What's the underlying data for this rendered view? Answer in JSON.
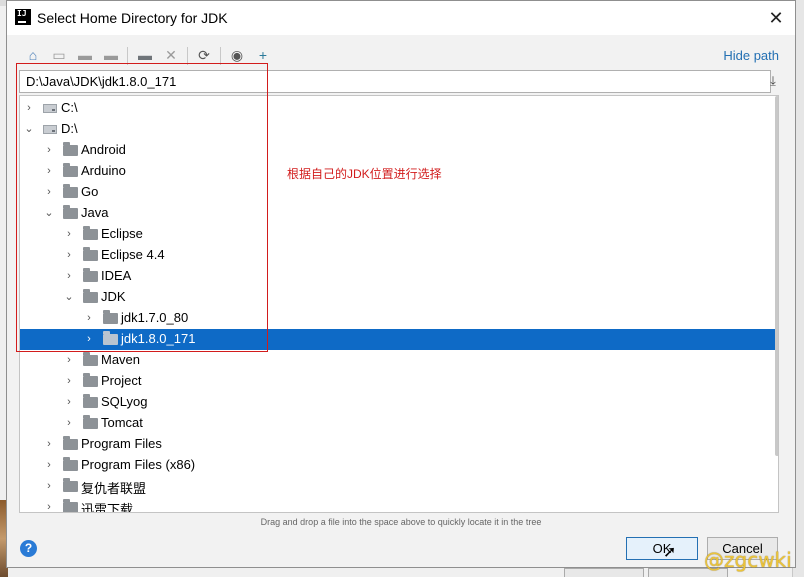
{
  "dialog": {
    "title": "Select Home Directory for JDK",
    "app_icon_text": "IJ"
  },
  "toolbar": {
    "hide_path_label": "Hide path",
    "icons": [
      "home-icon",
      "desktop-icon",
      "project-folder-icon",
      "module-folder-icon",
      "new-folder-icon",
      "delete-icon",
      "refresh-icon",
      "show-hidden-icon",
      "add-icon"
    ]
  },
  "path": {
    "value": "D:\\Java\\JDK\\jdk1.8.0_171"
  },
  "tree": {
    "items": [
      {
        "label": "C:\\",
        "type": "drive",
        "expanded": false
      },
      {
        "label": "D:\\",
        "type": "drive",
        "expanded": true
      },
      {
        "label": "Android",
        "type": "folder",
        "expanded": false
      },
      {
        "label": "Arduino",
        "type": "folder",
        "expanded": false
      },
      {
        "label": "Go",
        "type": "folder",
        "expanded": false
      },
      {
        "label": "Java",
        "type": "folder",
        "expanded": true
      },
      {
        "label": "Eclipse",
        "type": "folder",
        "expanded": false
      },
      {
        "label": "Eclipse 4.4",
        "type": "folder",
        "expanded": false
      },
      {
        "label": "IDEA",
        "type": "folder",
        "expanded": false
      },
      {
        "label": "JDK",
        "type": "folder",
        "expanded": true
      },
      {
        "label": "jdk1.7.0_80",
        "type": "folder",
        "expanded": false
      },
      {
        "label": "jdk1.8.0_171",
        "type": "folder",
        "expanded": false,
        "selected": true
      },
      {
        "label": "Maven",
        "type": "folder",
        "expanded": false
      },
      {
        "label": "Project",
        "type": "folder",
        "expanded": false
      },
      {
        "label": "SQLyog",
        "type": "folder",
        "expanded": false
      },
      {
        "label": "Tomcat",
        "type": "folder",
        "expanded": false
      },
      {
        "label": "Program Files",
        "type": "folder",
        "expanded": false
      },
      {
        "label": "Program Files (x86)",
        "type": "folder",
        "expanded": false
      },
      {
        "label": "复仇者联盟",
        "type": "folder",
        "expanded": false
      },
      {
        "label": "迅雷下载",
        "type": "folder",
        "expanded": false
      }
    ]
  },
  "annotation": "根据自己的JDK位置进行选择",
  "hint": "Drag and drop a file into the space above to quickly locate it in the tree",
  "buttons": {
    "help": "?",
    "ok": "OK",
    "cancel": "Cancel"
  },
  "watermark": "@zgcwki",
  "colors": {
    "selection": "#0e6ac6",
    "link": "#2470b3",
    "annotation": "#d21c1c"
  }
}
